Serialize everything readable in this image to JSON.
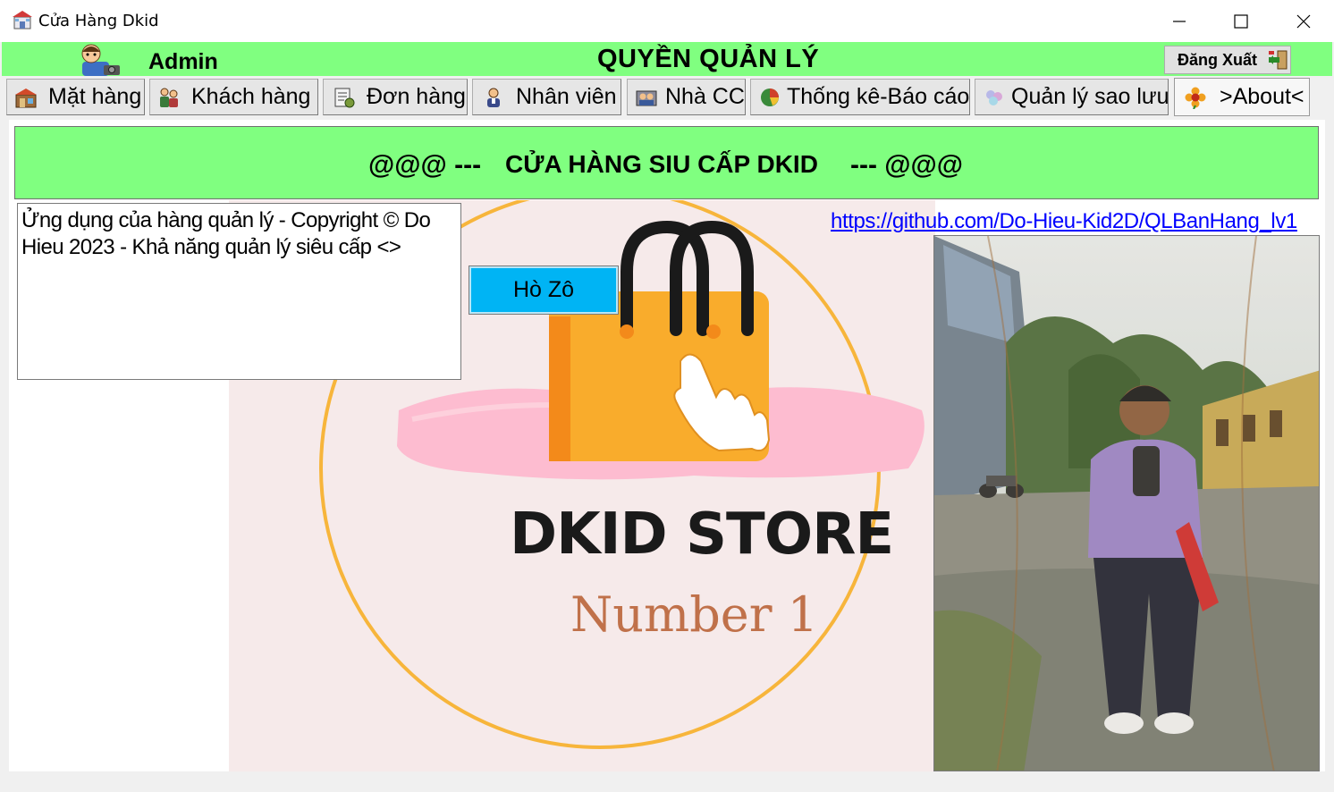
{
  "window": {
    "title": "Cửa Hàng Dkid",
    "icon": "store-app-icon"
  },
  "header": {
    "user_label": "Admin",
    "role_title": "QUYỀN QUẢN LÝ",
    "logout_label": "Đăng Xuất"
  },
  "tabs": [
    {
      "label": "Mặt hàng",
      "icon": "warehouse-icon"
    },
    {
      "label": "Khách hàng",
      "icon": "customers-icon"
    },
    {
      "label": "Đơn hàng",
      "icon": "invoice-icon"
    },
    {
      "label": "Nhân viên",
      "icon": "employee-icon"
    },
    {
      "label": "Nhà CC",
      "icon": "supplier-icon"
    },
    {
      "label": "Thống kê-Báo cáo",
      "icon": "report-icon"
    },
    {
      "label": "Quản lý sao lưu",
      "icon": "backup-icon"
    },
    {
      "label": ">About<",
      "icon": "flower-icon",
      "active": true
    }
  ],
  "banner": {
    "left": "@@@ ---",
    "title": "CỬA HÀNG SIU CẤP DKID",
    "right": "--- @@@"
  },
  "about": {
    "description": "Ửng dụng của hàng quản lý - Copyright © Do Hieu 2023 - Khả năng quản lý siêu cấp <>",
    "button_label": "Hò Zô",
    "github_link": "https://github.com/Do-Hieu-Kid2D/QLBanHang_lv1"
  },
  "store_logo": {
    "name": "DKID STORE",
    "tagline": "Number 1"
  },
  "colors": {
    "header_green": "#80ff80",
    "button_blue": "#00b4f4",
    "logo_orange": "#f9ac2c",
    "logo_ring": "#f7b53b",
    "tagline_brown": "#c0714a",
    "link_blue": "#0000ff"
  }
}
